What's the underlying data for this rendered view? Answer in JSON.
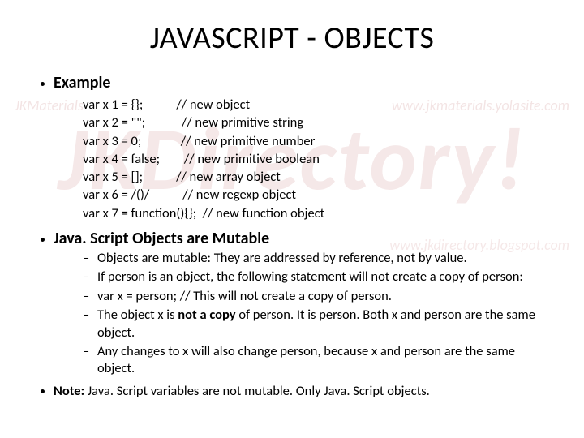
{
  "watermark": {
    "big": "JKDirectory!",
    "left_small": "JKMaterials",
    "right_small": "www.jkmaterials.yolasite.com",
    "right_small2": "www.jkdirectory.blogspot.com"
  },
  "title": "JAVASCRIPT - OBJECTS",
  "section1": {
    "heading": "Example",
    "code": "var x 1 = {};           // new object\nvar x 2 = \"\";            // new primitive string\nvar x 3 = 0;             // new primitive number\nvar x 4 = false;        // new primitive boolean\nvar x 5 = [];           // new array object\nvar x 6 = /()/           // new regexp object\nvar x 7 = function(){};  // new function object"
  },
  "section2": {
    "heading": "Java. Script Objects are Mutable",
    "items": [
      "Objects are mutable: They are addressed by reference, not by value.",
      "If person is an object, the following statement will not create a copy of person:",
      "var x = person; // This will not create a copy of person.",
      "",
      "Any changes to x will also change person, because x and person are the same object."
    ],
    "item4_pre": "The object x is ",
    "item4_bold": "not a copy",
    "item4_post": " of person. It is person. Both x and person are the same object."
  },
  "note": {
    "bold": "Note:",
    "text": " Java. Script variables are not mutable. Only Java. Script objects."
  }
}
